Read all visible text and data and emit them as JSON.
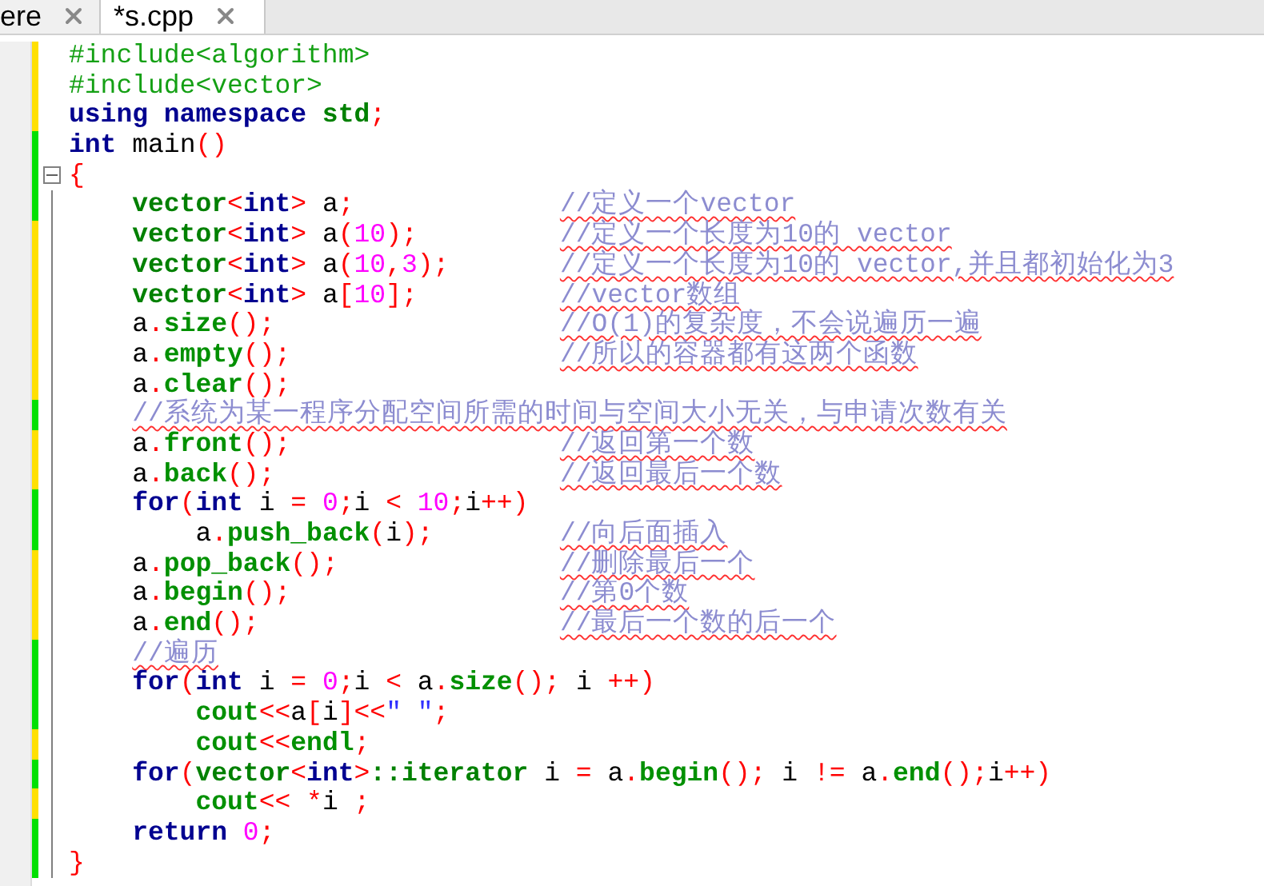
{
  "tabs": [
    {
      "label": "ere",
      "selected": false
    },
    {
      "label": "*s.cpp",
      "selected": true
    }
  ],
  "lines": [
    {
      "saved": false,
      "fold_start": false,
      "code": [
        {
          "kind": "directive",
          "text": "#include<algorithm>"
        }
      ]
    },
    {
      "saved": false,
      "fold_start": false,
      "code": [
        {
          "kind": "directive",
          "text": "#include<vector>"
        }
      ]
    },
    {
      "saved": false,
      "fold_start": false,
      "code": [
        {
          "kind": "keyword",
          "text": "using namespace"
        },
        {
          "kind": "type",
          "text": " std"
        },
        {
          "kind": "punct",
          "text": ";"
        }
      ]
    },
    {
      "saved": true,
      "fold_start": false,
      "code": [
        {
          "kind": "keyword",
          "text": "int"
        },
        {
          "kind": "ident",
          "text": " main"
        },
        {
          "kind": "punct",
          "text": "()"
        }
      ]
    },
    {
      "saved": true,
      "fold_start": true,
      "code": [
        {
          "kind": "punct",
          "text": "{"
        }
      ]
    },
    {
      "saved": true,
      "fold_start": false,
      "code": [
        {
          "kind": "type",
          "text": "    vector"
        },
        {
          "kind": "punct",
          "text": "<"
        },
        {
          "kind": "keyword",
          "text": "int"
        },
        {
          "kind": "punct",
          "text": ">"
        },
        {
          "kind": "ident",
          "text": " a"
        },
        {
          "kind": "punct",
          "text": ";"
        }
      ],
      "comment": "//定义一个vector"
    },
    {
      "saved": false,
      "fold_start": false,
      "code": [
        {
          "kind": "type",
          "text": "    vector"
        },
        {
          "kind": "punct",
          "text": "<"
        },
        {
          "kind": "keyword",
          "text": "int"
        },
        {
          "kind": "punct",
          "text": ">"
        },
        {
          "kind": "ident",
          "text": " a"
        },
        {
          "kind": "punct",
          "text": "("
        },
        {
          "kind": "number",
          "text": "10"
        },
        {
          "kind": "punct",
          "text": ");"
        }
      ],
      "comment": "//定义一个长度为10的 vector"
    },
    {
      "saved": false,
      "fold_start": false,
      "code": [
        {
          "kind": "type",
          "text": "    vector"
        },
        {
          "kind": "punct",
          "text": "<"
        },
        {
          "kind": "keyword",
          "text": "int"
        },
        {
          "kind": "punct",
          "text": ">"
        },
        {
          "kind": "ident",
          "text": " a"
        },
        {
          "kind": "punct",
          "text": "("
        },
        {
          "kind": "number",
          "text": "10"
        },
        {
          "kind": "punct",
          "text": ","
        },
        {
          "kind": "number",
          "text": "3"
        },
        {
          "kind": "punct",
          "text": ");"
        }
      ],
      "comment": "//定义一个长度为10的 vector,并且都初始化为3"
    },
    {
      "saved": false,
      "fold_start": false,
      "code": [
        {
          "kind": "type",
          "text": "    vector"
        },
        {
          "kind": "punct",
          "text": "<"
        },
        {
          "kind": "keyword",
          "text": "int"
        },
        {
          "kind": "punct",
          "text": ">"
        },
        {
          "kind": "ident",
          "text": " a"
        },
        {
          "kind": "punct",
          "text": "["
        },
        {
          "kind": "number",
          "text": "10"
        },
        {
          "kind": "punct",
          "text": "];"
        }
      ],
      "comment": "//vector数组"
    },
    {
      "saved": false,
      "fold_start": false,
      "code": [
        {
          "kind": "ident",
          "text": "    a"
        },
        {
          "kind": "punct",
          "text": "."
        },
        {
          "kind": "method",
          "text": "size"
        },
        {
          "kind": "punct",
          "text": "();"
        }
      ],
      "comment": "//O(1)的复杂度，不会说遍历一遍"
    },
    {
      "saved": false,
      "fold_start": false,
      "code": [
        {
          "kind": "ident",
          "text": "    a"
        },
        {
          "kind": "punct",
          "text": "."
        },
        {
          "kind": "method",
          "text": "empty"
        },
        {
          "kind": "punct",
          "text": "();"
        }
      ],
      "comment": "//所以的容器都有这两个函数"
    },
    {
      "saved": false,
      "fold_start": false,
      "code": [
        {
          "kind": "ident",
          "text": "    a"
        },
        {
          "kind": "punct",
          "text": "."
        },
        {
          "kind": "method",
          "text": "clear"
        },
        {
          "kind": "punct",
          "text": "();"
        }
      ]
    },
    {
      "saved": true,
      "fold_start": false,
      "comment": "    //系统为某一程序分配空间所需的时间与空间大小无关，与申请次数有关"
    },
    {
      "saved": false,
      "fold_start": false,
      "code": [
        {
          "kind": "ident",
          "text": "    a"
        },
        {
          "kind": "punct",
          "text": "."
        },
        {
          "kind": "method",
          "text": "front"
        },
        {
          "kind": "punct",
          "text": "();"
        }
      ],
      "comment": "//返回第一个数"
    },
    {
      "saved": false,
      "fold_start": false,
      "code": [
        {
          "kind": "ident",
          "text": "    a"
        },
        {
          "kind": "punct",
          "text": "."
        },
        {
          "kind": "method",
          "text": "back"
        },
        {
          "kind": "punct",
          "text": "();"
        }
      ],
      "comment": "//返回最后一个数"
    },
    {
      "saved": true,
      "fold_start": false,
      "code": [
        {
          "kind": "keyword",
          "text": "    for"
        },
        {
          "kind": "punct",
          "text": "("
        },
        {
          "kind": "keyword",
          "text": "int"
        },
        {
          "kind": "ident",
          "text": " i "
        },
        {
          "kind": "punct",
          "text": "="
        },
        {
          "kind": "number",
          "text": " 0"
        },
        {
          "kind": "punct",
          "text": ";"
        },
        {
          "kind": "ident",
          "text": "i "
        },
        {
          "kind": "punct",
          "text": "<"
        },
        {
          "kind": "number",
          "text": " 10"
        },
        {
          "kind": "punct",
          "text": ";"
        },
        {
          "kind": "ident",
          "text": "i"
        },
        {
          "kind": "punct",
          "text": "++)"
        }
      ]
    },
    {
      "saved": true,
      "fold_start": false,
      "code": [
        {
          "kind": "ident",
          "text": "        a"
        },
        {
          "kind": "punct",
          "text": "."
        },
        {
          "kind": "method",
          "text": "push_back"
        },
        {
          "kind": "punct",
          "text": "("
        },
        {
          "kind": "ident",
          "text": "i"
        },
        {
          "kind": "punct",
          "text": ");"
        }
      ],
      "comment": "//向后面插入"
    },
    {
      "saved": false,
      "fold_start": false,
      "code": [
        {
          "kind": "ident",
          "text": "    a"
        },
        {
          "kind": "punct",
          "text": "."
        },
        {
          "kind": "method",
          "text": "pop_back"
        },
        {
          "kind": "punct",
          "text": "();"
        }
      ],
      "comment": "//删除最后一个"
    },
    {
      "saved": false,
      "fold_start": false,
      "code": [
        {
          "kind": "ident",
          "text": "    a"
        },
        {
          "kind": "punct",
          "text": "."
        },
        {
          "kind": "method",
          "text": "begin"
        },
        {
          "kind": "punct",
          "text": "();"
        }
      ],
      "comment": "//第0个数"
    },
    {
      "saved": false,
      "fold_start": false,
      "code": [
        {
          "kind": "ident",
          "text": "    a"
        },
        {
          "kind": "punct",
          "text": "."
        },
        {
          "kind": "method",
          "text": "end"
        },
        {
          "kind": "punct",
          "text": "();"
        }
      ],
      "comment": "//最后一个数的后一个"
    },
    {
      "saved": true,
      "fold_start": false,
      "comment": "    //遍历"
    },
    {
      "saved": true,
      "fold_start": false,
      "code": [
        {
          "kind": "keyword",
          "text": "    for"
        },
        {
          "kind": "punct",
          "text": "("
        },
        {
          "kind": "keyword",
          "text": "int"
        },
        {
          "kind": "ident",
          "text": " i "
        },
        {
          "kind": "punct",
          "text": "="
        },
        {
          "kind": "number",
          "text": " 0"
        },
        {
          "kind": "punct",
          "text": ";"
        },
        {
          "kind": "ident",
          "text": "i "
        },
        {
          "kind": "punct",
          "text": "<"
        },
        {
          "kind": "ident",
          "text": " a"
        },
        {
          "kind": "punct",
          "text": "."
        },
        {
          "kind": "method",
          "text": "size"
        },
        {
          "kind": "punct",
          "text": "();"
        },
        {
          "kind": "ident",
          "text": " i "
        },
        {
          "kind": "punct",
          "text": "++)"
        }
      ]
    },
    {
      "saved": true,
      "fold_start": false,
      "code": [
        {
          "kind": "method",
          "text": "        cout"
        },
        {
          "kind": "punct",
          "text": "<<"
        },
        {
          "kind": "ident",
          "text": "a"
        },
        {
          "kind": "punct",
          "text": "["
        },
        {
          "kind": "ident",
          "text": "i"
        },
        {
          "kind": "punct",
          "text": "]<<"
        },
        {
          "kind": "string",
          "text": "\" \""
        },
        {
          "kind": "punct",
          "text": ";"
        }
      ]
    },
    {
      "saved": false,
      "fold_start": false,
      "code": [
        {
          "kind": "method",
          "text": "        cout"
        },
        {
          "kind": "punct",
          "text": "<<"
        },
        {
          "kind": "method",
          "text": "endl"
        },
        {
          "kind": "punct",
          "text": ";"
        }
      ]
    },
    {
      "saved": true,
      "fold_start": false,
      "code": [
        {
          "kind": "keyword",
          "text": "    for"
        },
        {
          "kind": "punct",
          "text": "("
        },
        {
          "kind": "type",
          "text": "vector"
        },
        {
          "kind": "punct",
          "text": "<"
        },
        {
          "kind": "keyword",
          "text": "int"
        },
        {
          "kind": "punct",
          "text": ">"
        },
        {
          "kind": "type",
          "text": "::iterator"
        },
        {
          "kind": "ident",
          "text": " i "
        },
        {
          "kind": "punct",
          "text": "="
        },
        {
          "kind": "ident",
          "text": " a"
        },
        {
          "kind": "punct",
          "text": "."
        },
        {
          "kind": "method",
          "text": "begin"
        },
        {
          "kind": "punct",
          "text": "();"
        },
        {
          "kind": "ident",
          "text": " i "
        },
        {
          "kind": "punct",
          "text": "!="
        },
        {
          "kind": "ident",
          "text": " a"
        },
        {
          "kind": "punct",
          "text": "."
        },
        {
          "kind": "method",
          "text": "end"
        },
        {
          "kind": "punct",
          "text": "();"
        },
        {
          "kind": "ident",
          "text": "i"
        },
        {
          "kind": "punct",
          "text": "++)"
        }
      ]
    },
    {
      "saved": false,
      "fold_start": false,
      "code": [
        {
          "kind": "method",
          "text": "        cout"
        },
        {
          "kind": "punct",
          "text": "<< *"
        },
        {
          "kind": "ident",
          "text": "i "
        },
        {
          "kind": "punct",
          "text": ";"
        }
      ]
    },
    {
      "saved": true,
      "fold_start": false,
      "code": [
        {
          "kind": "keyword",
          "text": "    return"
        },
        {
          "kind": "number",
          "text": " 0"
        },
        {
          "kind": "punct",
          "text": ";"
        }
      ]
    },
    {
      "saved": true,
      "fold_start": false,
      "code": [
        {
          "kind": "punct",
          "text": "}"
        }
      ]
    }
  ]
}
